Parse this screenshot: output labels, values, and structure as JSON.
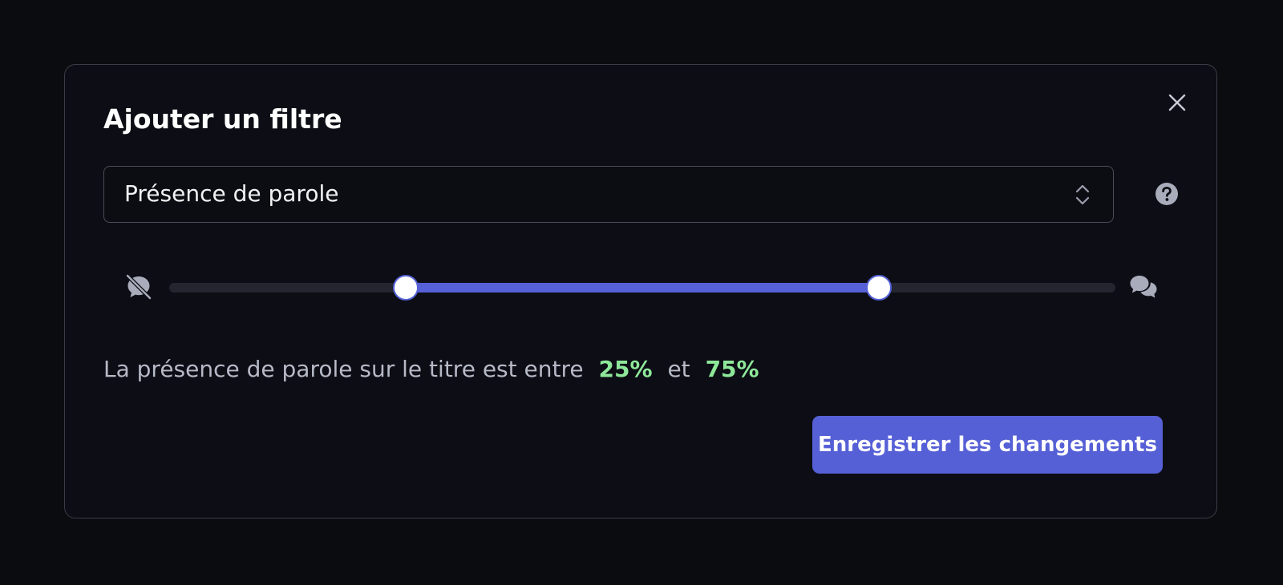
{
  "dialog": {
    "title": "Ajouter un filtre",
    "close_icon": "close-icon"
  },
  "filter_select": {
    "selected": "Présence de parole",
    "chevron_icon": "chevron-up-down-icon"
  },
  "help": {
    "icon": "question-circle-icon"
  },
  "slider": {
    "min_icon": "speech-off-icon",
    "max_icon": "chat-bubbles-icon",
    "low": 25,
    "high": 75,
    "min": 0,
    "max": 100
  },
  "summary": {
    "prefix": "La présence de parole sur le titre est entre",
    "low_text": "25%",
    "conjunction": "et",
    "high_text": "75%"
  },
  "actions": {
    "save_label": "Enregistrer les changements"
  },
  "colors": {
    "background": "#0b0c10",
    "modal": "#0d0e15",
    "accent": "#5660d6",
    "value_green": "#8ee89a",
    "text_muted": "#b6b9c6"
  }
}
